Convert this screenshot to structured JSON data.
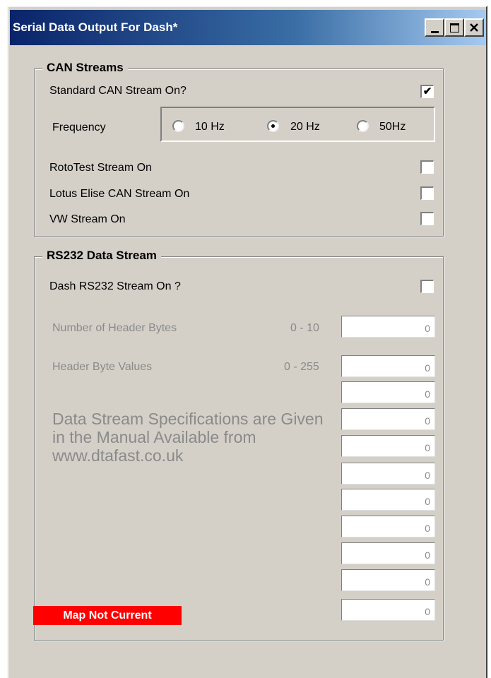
{
  "window": {
    "title": "Serial Data Output For Dash*",
    "controls": [
      "minimize-icon",
      "maximize-icon",
      "close-icon"
    ]
  },
  "can_streams": {
    "legend": "CAN Streams",
    "standard_label": "Standard CAN Stream On?",
    "standard_checked": true,
    "frequency_label": "Frequency",
    "frequency_options": [
      {
        "label": "10 Hz",
        "selected": false
      },
      {
        "label": "20 Hz",
        "selected": true
      },
      {
        "label": "50Hz",
        "selected": false
      }
    ],
    "rototest_label": "RotoTest Stream On",
    "lotus_label": "Lotus Elise CAN Stream On",
    "vw_label": "VW Stream On",
    "check_mark": "✔"
  },
  "rs232": {
    "legend": "RS232 Data Stream",
    "dash_label": "Dash RS232 Stream On ?",
    "header_bytes_label": "Number of Header Bytes",
    "header_bytes_range": "0 - 10",
    "header_bytes_value": "0",
    "header_values_label": "Header Byte Values",
    "header_values_range": "0 - 255",
    "header_values": [
      "0",
      "0",
      "0",
      "0",
      "0",
      "0",
      "0",
      "0",
      "0",
      "0"
    ],
    "spec_text": "Data Stream Specifications are Given in the Manual Available from www.dtafast.co.uk"
  },
  "status": {
    "text": "Map Not Current",
    "color": "#ff0000"
  }
}
